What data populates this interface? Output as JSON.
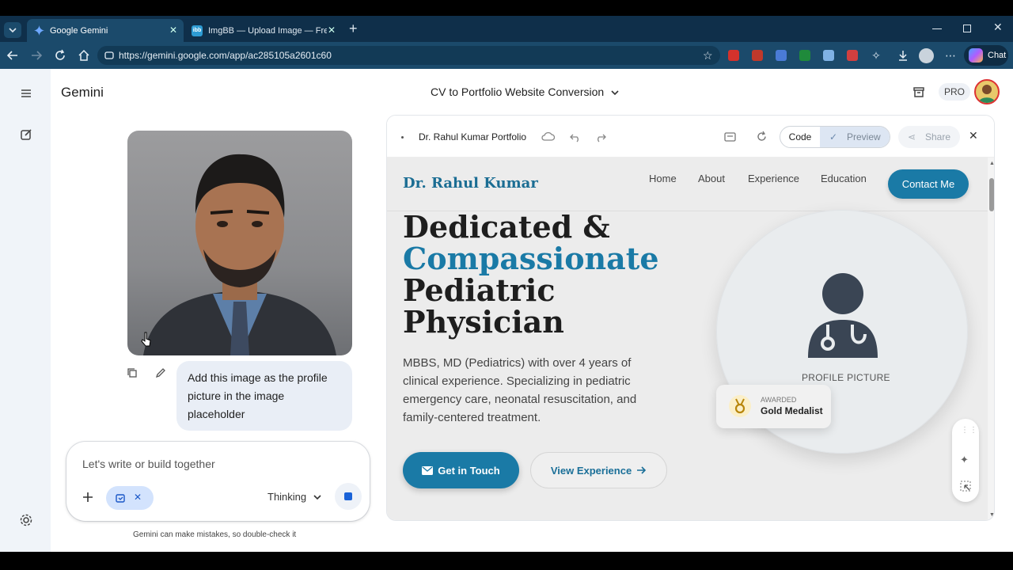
{
  "browser": {
    "tabs": [
      {
        "title": "Google Gemini",
        "active": true
      },
      {
        "title": "ImgBB — Upload Image — Free In",
        "active": false
      }
    ],
    "url": "https://gemini.google.com/app/ac285105a2601c60",
    "chat_label": "Chat"
  },
  "app": {
    "name": "Gemini",
    "conversation_title": "CV to Portfolio Website Conversion",
    "plan_badge": "PRO"
  },
  "chat": {
    "user_message": "Add this image as the profile picture in the image placeholder",
    "composer_placeholder": "Let's write or build together",
    "mode_label": "Thinking",
    "disclaimer": "Gemini can make mistakes, so double-check it"
  },
  "canvas": {
    "title": "Dr. Rahul Kumar Portfolio",
    "code_label": "Code",
    "preview_label": "Preview",
    "share_label": "Share"
  },
  "site": {
    "brand": "Dr. Rahul Kumar",
    "nav": [
      "Home",
      "About",
      "Experience",
      "Education"
    ],
    "contact_label": "Contact Me",
    "hero_line1": "Dedicated &",
    "hero_line2": "Compassionate",
    "hero_line3": "Pediatric",
    "hero_line4": "Physician",
    "description": "MBBS, MD (Pediatrics) with over 4 years of clinical experience. Specializing in pediatric emergency care, neonatal resuscitation, and family-centered treatment.",
    "cta_primary": "Get in Touch",
    "cta_secondary": "View Experience",
    "profile_placeholder": "PROFILE PICTURE",
    "award_kicker": "AWARDED",
    "award_title": "Gold Medalist"
  },
  "colors": {
    "accent": "#1a7aa6",
    "browser_frame": "#1b4a6b",
    "user_bubble": "#e9eef6"
  }
}
